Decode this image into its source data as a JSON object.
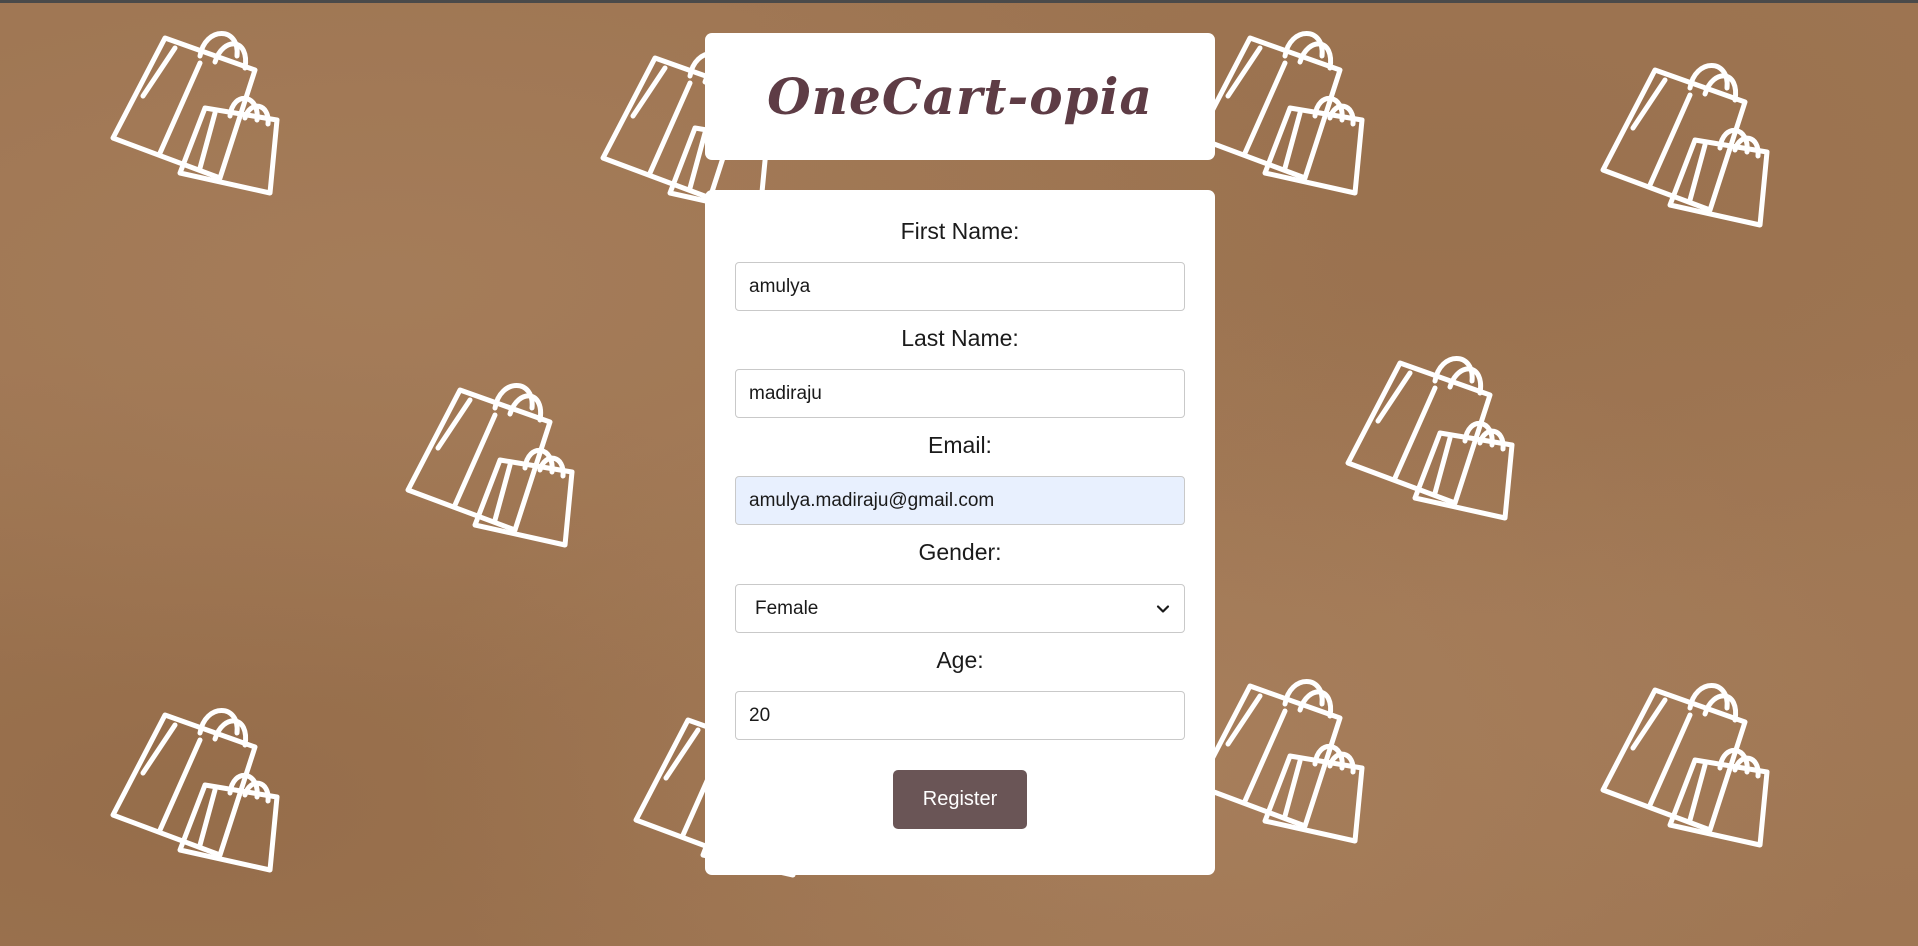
{
  "app": {
    "title": "OneCart-opia"
  },
  "form": {
    "first_name": {
      "label": "First Name:",
      "value": "amulya"
    },
    "last_name": {
      "label": "Last Name:",
      "value": "madiraju"
    },
    "email": {
      "label": "Email:",
      "value": "amulya.madiraju@gmail.com"
    },
    "gender": {
      "label": "Gender:",
      "value": "Female"
    },
    "age": {
      "label": "Age:",
      "value": "20"
    },
    "submit_label": "Register"
  },
  "colors": {
    "background": "#9e7552",
    "title_text": "#5e3c45",
    "button": "#6a5556",
    "autofill": "#e8f0fe"
  },
  "icons": {
    "background_pattern": "shopping-bags-icon",
    "select_arrow": "chevron-down-icon"
  }
}
